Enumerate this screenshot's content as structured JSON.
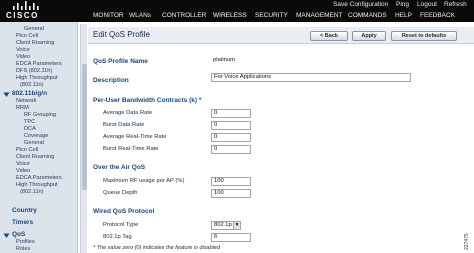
{
  "brand": {
    "logo_text": "CISCO"
  },
  "utility_links": [
    {
      "label": "Save Configuration"
    },
    {
      "label": "Ping"
    },
    {
      "label": "Logout"
    },
    {
      "label": "Refresh"
    }
  ],
  "menu": [
    {
      "label": "MONITOR"
    },
    {
      "label": "WLANs"
    },
    {
      "label": "CONTROLLER"
    },
    {
      "label": "WIRELESS"
    },
    {
      "label": "SECURITY"
    },
    {
      "label": "MANAGEMENT"
    },
    {
      "label": "COMMANDS"
    },
    {
      "label": "HELP"
    },
    {
      "label": "FEEDBACK"
    }
  ],
  "sidebar": {
    "items": [
      {
        "label": "General"
      },
      {
        "label": "Pico Cell"
      },
      {
        "label": "Client Roaming"
      },
      {
        "label": "Voice"
      },
      {
        "label": "Video"
      },
      {
        "label": "EDCA Parameters"
      },
      {
        "label": "DFS (802.11h)"
      },
      {
        "label": "High Throughput"
      },
      {
        "label": "(802.11n)"
      },
      {
        "label": "802.11b/g/n"
      },
      {
        "label": "Network"
      },
      {
        "label": "RRM"
      },
      {
        "label": "RF Grouping"
      },
      {
        "label": "TPC"
      },
      {
        "label": "DCA"
      },
      {
        "label": "Coverage"
      },
      {
        "label": "General"
      },
      {
        "label": "Pico Cell"
      },
      {
        "label": "Client Roaming"
      },
      {
        "label": "Voice"
      },
      {
        "label": "Video"
      },
      {
        "label": "EDCA Parameters"
      },
      {
        "label": "High Throughput"
      },
      {
        "label": "(802.11n)"
      },
      {
        "label": "Country"
      },
      {
        "label": "Timers"
      },
      {
        "label": "QoS"
      },
      {
        "label": "Profiles"
      },
      {
        "label": "Roles"
      }
    ]
  },
  "page": {
    "title": "Edit QoS Profile",
    "buttons": {
      "back": "< Back",
      "apply": "Apply",
      "reset": "Reset to defaults"
    }
  },
  "form": {
    "profile_name_label": "QoS Profile Name",
    "profile_name_value": "platinum",
    "description_label": "Description",
    "description_value": "For Voice Applications",
    "bandwidth_section": "Per-User Bandwidth Contracts (k) *",
    "bandwidth_fields": [
      {
        "label": "Average Data Rate",
        "value": "0"
      },
      {
        "label": "Burst Data Rate",
        "value": "0"
      },
      {
        "label": "Average Real-Time Rate",
        "value": "0"
      },
      {
        "label": "Burst Real-Time Rate",
        "value": "0"
      }
    ],
    "air_section": "Over the Air QoS",
    "air_fields": [
      {
        "label": "Maximum RF usage per AP (%)",
        "value": "100"
      },
      {
        "label": "Queue Depth",
        "value": "100"
      }
    ],
    "wired_section": "Wired QoS Protocol",
    "protocol_type_label": "Protocol Type",
    "protocol_type_value": "802.1p",
    "tag_label": "802.1p Tag",
    "tag_value": "6",
    "footnote": "* The value zero (0) indicates the feature is disabled"
  },
  "figure_ref": "227475"
}
